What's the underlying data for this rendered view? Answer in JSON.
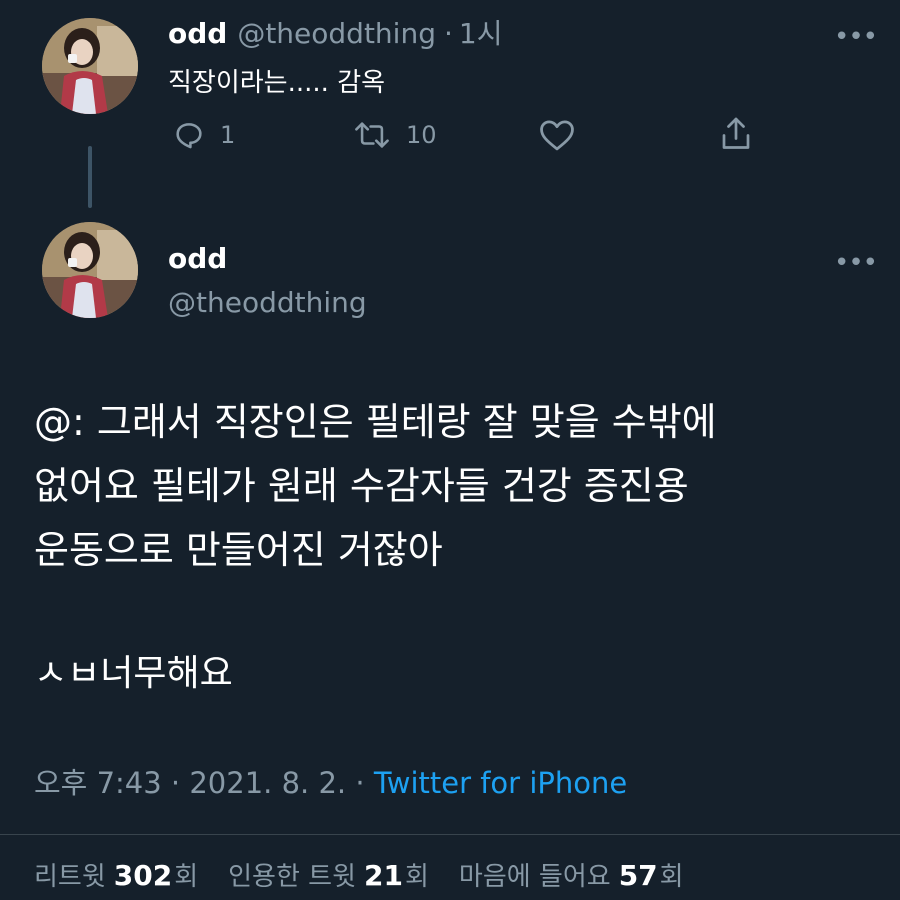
{
  "tweet1": {
    "name": "odd",
    "handle": "@theoddthing",
    "time_sep": "·",
    "time": "1시",
    "more": "•••",
    "text": "직장이라는..... 감옥",
    "reply_count": "1",
    "retweet_count": "10"
  },
  "tweet2": {
    "name": "odd",
    "handle": "@theoddthing",
    "more": "•••",
    "text": "@: 그래서 직장인은 필테랑 잘 맞을 수밖에\n없어요 필테가 원래 수감자들 건강 증진용\n운동으로 만들어진 거잖아",
    "subtext": "ㅅㅂ너무해요",
    "timestamp": "오후 7:43 · 2021. 8. 2. · ",
    "source": "Twitter for iPhone"
  },
  "stats": {
    "retweets_label": "리트윗",
    "retweets_count": "302",
    "retweets_suffix": "회",
    "quotes_label": "인용한 트윗",
    "quotes_count": "21",
    "quotes_suffix": "회",
    "likes_label": "마음에 들어요",
    "likes_count": "57",
    "likes_suffix": "회"
  },
  "colors": {
    "background": "#15202b",
    "secondary_text": "#8899a6",
    "link": "#1da1f2",
    "divider": "#38444d"
  }
}
